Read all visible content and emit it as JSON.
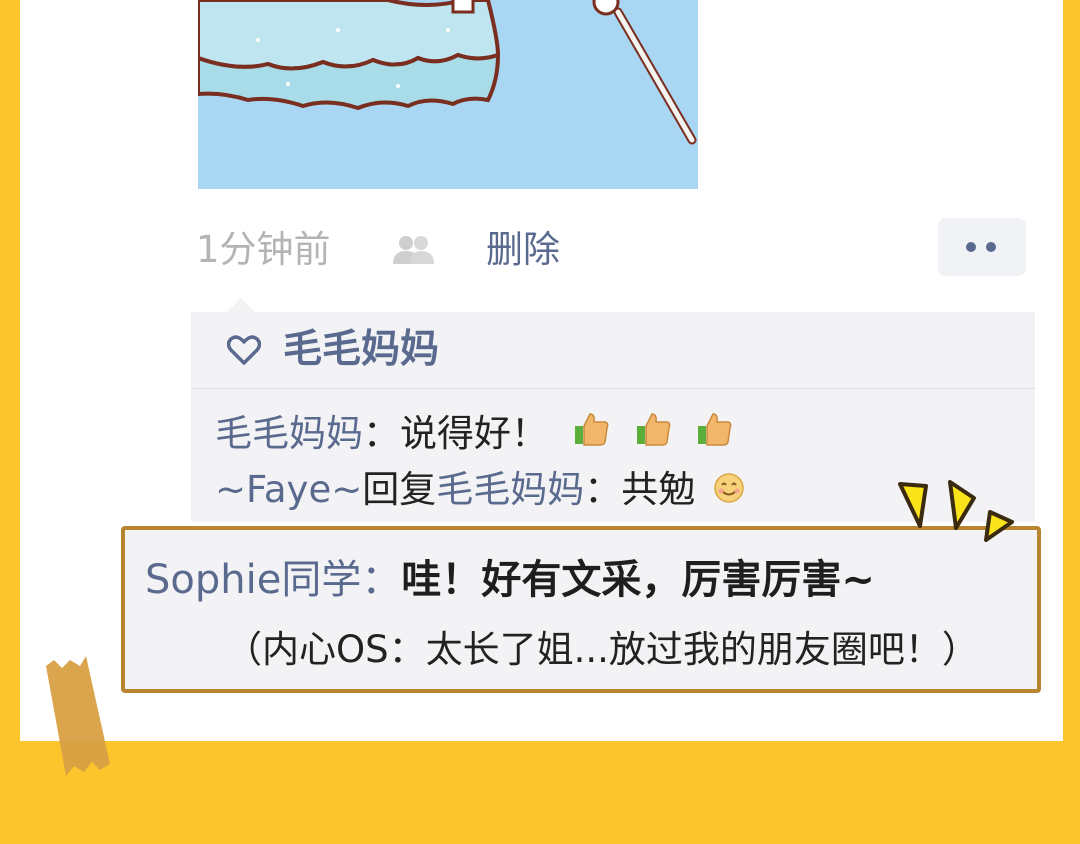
{
  "post": {
    "time": "1分钟前",
    "delete_label": "删除"
  },
  "likes": {
    "names": "毛毛妈妈"
  },
  "comments": [
    {
      "author": "毛毛妈妈",
      "separator": "：",
      "text": "说得好！"
    },
    {
      "author": "~Faye~",
      "reply_word": "回复",
      "reply_to": "毛毛妈妈",
      "separator": "：",
      "text": "共勉"
    }
  ],
  "highlight_comment": {
    "author": "Sophie同学：",
    "text": "哇！好有文采，厉害厉害~",
    "inner_thought": "（内心OS：太长了姐...放过我的朋友圈吧！）"
  },
  "icons": {
    "privacy": "friends-visibility-icon",
    "more": "more-dots-icon",
    "like": "heart-icon",
    "thumbs": "thumbs-up-icon",
    "smile": "smile-emoji-icon"
  },
  "colors": {
    "background": "#FDC52C",
    "link_blue": "#5A6A8E",
    "highlight_border": "#B7852F"
  }
}
